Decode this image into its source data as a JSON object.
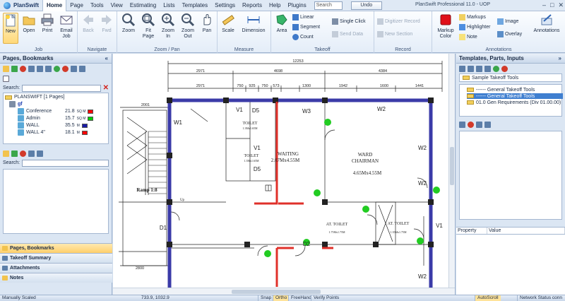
{
  "app": {
    "name": "PlanSwift",
    "window_title": "PlanSwift Professional 11.0 - UOP",
    "search_placeholder": "Search",
    "undo_label": "Undo"
  },
  "menu": [
    "Home",
    "Page",
    "Tools",
    "View",
    "Estimating",
    "Lists",
    "Templates",
    "Settings",
    "Reports",
    "Help",
    "Plugins"
  ],
  "ribbon": {
    "groups": {
      "job": "Job",
      "navigate": "Navigate",
      "zoom_pan": "Zoom / Pan",
      "measure": "Measure",
      "takeoff": "Takeoff",
      "record": "Record",
      "annotations": "Annotations"
    },
    "buttons": {
      "new": "New",
      "open": "Open",
      "print": "Print",
      "email_job": "Email Job",
      "back": "Back",
      "fwd": "Fwd",
      "zoom": "Zoom",
      "fit_page": "Fit Page",
      "zoom_in": "Zoom In",
      "zoom_out": "Zoom Out",
      "pan": "Pan",
      "scale": "Scale",
      "dimension": "Dimension",
      "area": "Area",
      "linear": "Linear",
      "segment": "Segment",
      "count": "Count",
      "single_click": "Single Click",
      "send_data": "Send Data",
      "digitizer_record": "Digitizer Record",
      "new_section": "New Section",
      "markup_color": "Markup Color",
      "markups": "Markups",
      "highlighter": "Highlighter",
      "note": "Note",
      "image": "Image",
      "overlay": "Overlay",
      "annotations": "Annotations"
    }
  },
  "left_panel": {
    "title": "Pages, Bookmarks",
    "search_label": "Search:",
    "tree": {
      "root": "PLANSWIFT [1 Pages]",
      "page": "gf",
      "items": [
        {
          "name": "Conference",
          "value": "21.8",
          "unit": "SQ M",
          "color": "#ff0000"
        },
        {
          "name": "Admin",
          "value": "15.7",
          "unit": "SQ M",
          "color": "#00cc00"
        },
        {
          "name": "WALL",
          "value": "35.5",
          "unit": "M",
          "color": "#1a1aa6"
        },
        {
          "name": "WALL 4\"",
          "value": "18.1",
          "unit": "M",
          "color": "#ff0000"
        }
      ]
    },
    "search_label_2": "Search:",
    "accordion": [
      "Pages, Bookmarks",
      "Takeoff Summary",
      "Attachments",
      "Notes"
    ]
  },
  "right_panel": {
    "title": "Templates, Parts, Inputs",
    "template_selector": "Sample Takeoff Tools",
    "tree": [
      "------ General Takeoff Tools",
      "------ General Takeoff Tools",
      "01.0  Gen Requirements (Div 01.00.00)"
    ],
    "properties": {
      "col1": "Property",
      "col2": "Value"
    }
  },
  "drawing": {
    "dimensions_top": [
      "12253"
    ],
    "dimensions_row2": [
      "2971",
      "4698",
      "4384"
    ],
    "dimensions_row3": [
      "2971",
      "750",
      "925",
      "750",
      "573",
      "1300",
      "1942",
      "1600",
      "1441"
    ],
    "dimension_left": "2001",
    "dimension_bottom": "2800",
    "rooms": [
      {
        "name": "TOILET",
        "size": "1.3Mx1.65M"
      },
      {
        "name": "TOILET",
        "size": "1.3Mx1.65M"
      },
      {
        "name": "WAITING",
        "size": "2.07Mx4.55M"
      },
      {
        "name": "WARD",
        "sub": "CHAIRMAN",
        "size": "4.65Mx4.55M"
      },
      {
        "name": "AT. TOILET",
        "size": "1.75Mx1.75M"
      },
      {
        "name": "AT. TOILET",
        "size": "1.35Mx1.75M"
      }
    ],
    "tags": [
      "V1",
      "D5",
      "W3",
      "W2",
      "W1",
      "V1",
      "D5",
      "W2",
      "D1",
      "D2",
      "W2",
      "V1",
      "W2"
    ],
    "ramp_label": "Ramp 1:8",
    "up_label": "Up"
  },
  "statusbar": {
    "scale": "Manually Scaled",
    "coords": "733.9, 1032.9",
    "snap": "Snap",
    "ortho": "Ortho",
    "freehand": "FreeHand",
    "verify_points": "Verify Points",
    "autoscroll": "AutoScroll",
    "network": "Network Status conn"
  },
  "colors": {
    "wall_blue": "#3b3ba8",
    "wall_red": "#e0302a",
    "count_green": "#22cc22",
    "accent": "#ffcf6b"
  }
}
